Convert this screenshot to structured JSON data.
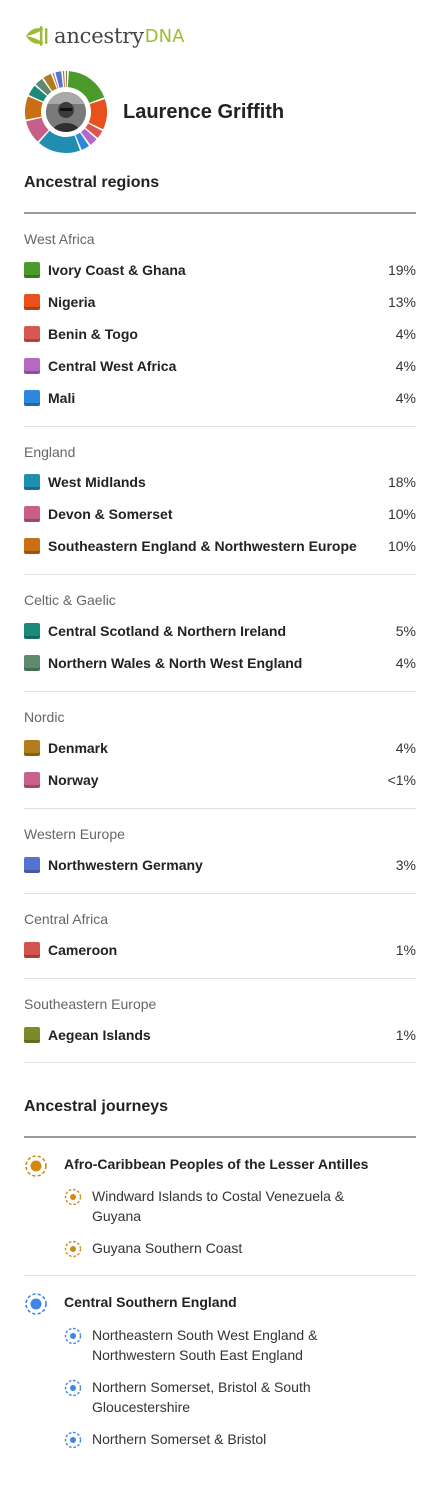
{
  "brand": {
    "name": "ancestry",
    "suffix": "DNA",
    "leaf_color": "#9cbc32"
  },
  "profile": {
    "name": "Laurence Griffith"
  },
  "regions_section": {
    "title": "Ancestral regions"
  },
  "region_groups": [
    {
      "name": "West Africa",
      "regions": [
        {
          "name": "Ivory Coast & Ghana",
          "pct": "19%",
          "value": 19,
          "color": "#4a9a2c"
        },
        {
          "name": "Nigeria",
          "pct": "13%",
          "value": 13,
          "color": "#e8501d"
        },
        {
          "name": "Benin & Togo",
          "pct": "4%",
          "value": 4,
          "color": "#d8584f"
        },
        {
          "name": "Central West Africa",
          "pct": "4%",
          "value": 4,
          "color": "#b46ac4"
        },
        {
          "name": "Mali",
          "pct": "4%",
          "value": 4,
          "color": "#2f86dd"
        }
      ]
    },
    {
      "name": "England",
      "regions": [
        {
          "name": "West Midlands",
          "pct": "18%",
          "value": 18,
          "color": "#1f8eb1"
        },
        {
          "name": "Devon & Somerset",
          "pct": "10%",
          "value": 10,
          "color": "#c76088"
        },
        {
          "name": "Southeastern England & Northwestern Europe",
          "pct": "10%",
          "value": 10,
          "color": "#c86e14"
        }
      ]
    },
    {
      "name": "Celtic & Gaelic",
      "regions": [
        {
          "name": "Central Scotland & Northern Ireland",
          "pct": "5%",
          "value": 5,
          "color": "#1c8a7a"
        },
        {
          "name": "Northern Wales & North West England",
          "pct": "4%",
          "value": 4,
          "color": "#5f8a6c"
        }
      ]
    },
    {
      "name": "Nordic",
      "regions": [
        {
          "name": "Denmark",
          "pct": "4%",
          "value": 4,
          "color": "#b07d1a"
        },
        {
          "name": "Norway",
          "pct": "<1%",
          "value": 0.5,
          "color": "#c85f8c"
        }
      ]
    },
    {
      "name": "Western Europe",
      "regions": [
        {
          "name": "Northwestern Germany",
          "pct": "3%",
          "value": 3,
          "color": "#5673cf"
        }
      ]
    },
    {
      "name": "Central Africa",
      "regions": [
        {
          "name": "Cameroon",
          "pct": "1%",
          "value": 1,
          "color": "#d2534b"
        }
      ]
    },
    {
      "name": "Southeastern Europe",
      "regions": [
        {
          "name": "Aegean Islands",
          "pct": "1%",
          "value": 1,
          "color": "#7a8c2a"
        }
      ]
    }
  ],
  "journeys_section": {
    "title": "Ancestral journeys"
  },
  "journeys": [
    {
      "name": "Afro-Caribbean Peoples of the Lesser Antilles",
      "color": "#d28a17",
      "subs": [
        "Windward Islands to Costal Venezuela & Guyana",
        "Guyana Southern Coast"
      ]
    },
    {
      "name": "Central Southern England",
      "color": "#3f86e8",
      "subs": [
        "Northeastern South West England & Northwestern South East England",
        "Northern Somerset, Bristol & South Gloucestershire",
        "Northern Somerset & Bristol"
      ]
    }
  ]
}
